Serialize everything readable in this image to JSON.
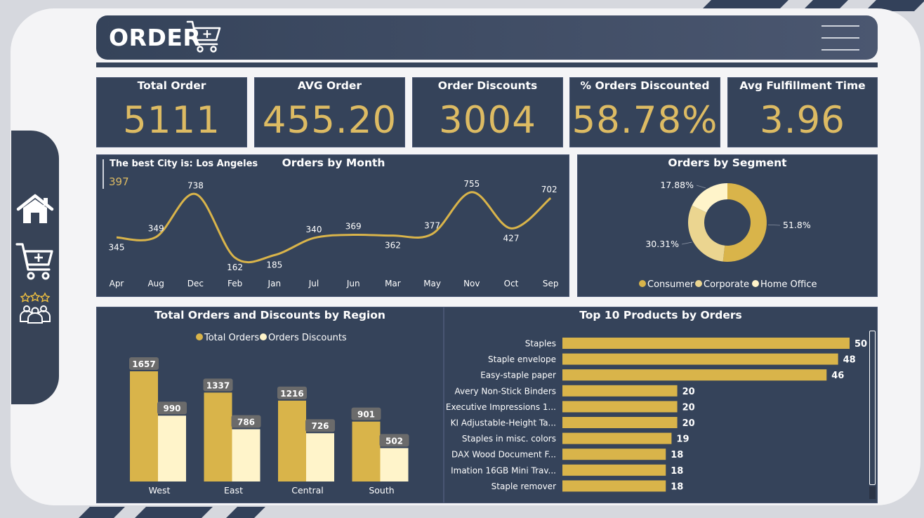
{
  "header": {
    "title": "ORDER"
  },
  "nav": [
    {
      "name": "home-icon"
    },
    {
      "name": "cart-plus-icon"
    },
    {
      "name": "customers-rating-icon"
    }
  ],
  "kpis": [
    {
      "label": "Total Order",
      "value": "5111"
    },
    {
      "label": "AVG Order",
      "value": "455.20"
    },
    {
      "label": "Order Discounts",
      "value": "3004"
    },
    {
      "label": "% Orders Discounted",
      "value": "58.78%"
    },
    {
      "label": "Avg Fulfillment Time",
      "value": "3.96"
    }
  ],
  "best_city": {
    "label": "The best City is: Los Angeles",
    "value": "397"
  },
  "colors": {
    "gold": "#d9b44a",
    "cream": "#fff4ca",
    "light_gold": "#ebd590",
    "panel": "#35435a",
    "accent_text": "#ddbb63"
  },
  "chart_data": [
    {
      "type": "line",
      "title": "Orders by Month",
      "categories": [
        "Apr",
        "Aug",
        "Dec",
        "Feb",
        "Jan",
        "Jul",
        "Jun",
        "Mar",
        "May",
        "Nov",
        "Oct",
        "Sep"
      ],
      "values": [
        345,
        349,
        738,
        162,
        185,
        340,
        369,
        362,
        377,
        755,
        427,
        702
      ]
    },
    {
      "type": "pie",
      "title": "Orders by Segment",
      "labels": [
        "Consumer",
        "Corporate",
        "Home Office"
      ],
      "values": [
        51.8,
        30.31,
        17.88
      ],
      "value_labels": [
        "51.8%",
        "30.31%",
        "17.88%"
      ],
      "legend": "bottom"
    },
    {
      "type": "bar",
      "title": "Total Orders and Discounts by Region",
      "categories": [
        "West",
        "East",
        "Central",
        "South"
      ],
      "series": [
        {
          "name": "Total Orders",
          "values": [
            1657,
            1337,
            1216,
            901
          ]
        },
        {
          "name": "Orders Discounts",
          "values": [
            990,
            786,
            726,
            502
          ]
        }
      ],
      "legend": "top"
    },
    {
      "type": "bar",
      "title": "Top 10 Products by Orders",
      "orientation": "horizontal",
      "categories": [
        "Staples",
        "Staple envelope",
        "Easy-staple paper",
        "Avery Non-Stick Binders",
        "Executive Impressions 1...",
        "KI Adjustable-Height Ta...",
        "Staples in misc. colors",
        "DAX Wood Document F...",
        "Imation 16GB Mini Trav...",
        "Staple remover"
      ],
      "values": [
        50,
        48,
        46,
        20,
        20,
        20,
        19,
        18,
        18,
        18
      ]
    }
  ]
}
